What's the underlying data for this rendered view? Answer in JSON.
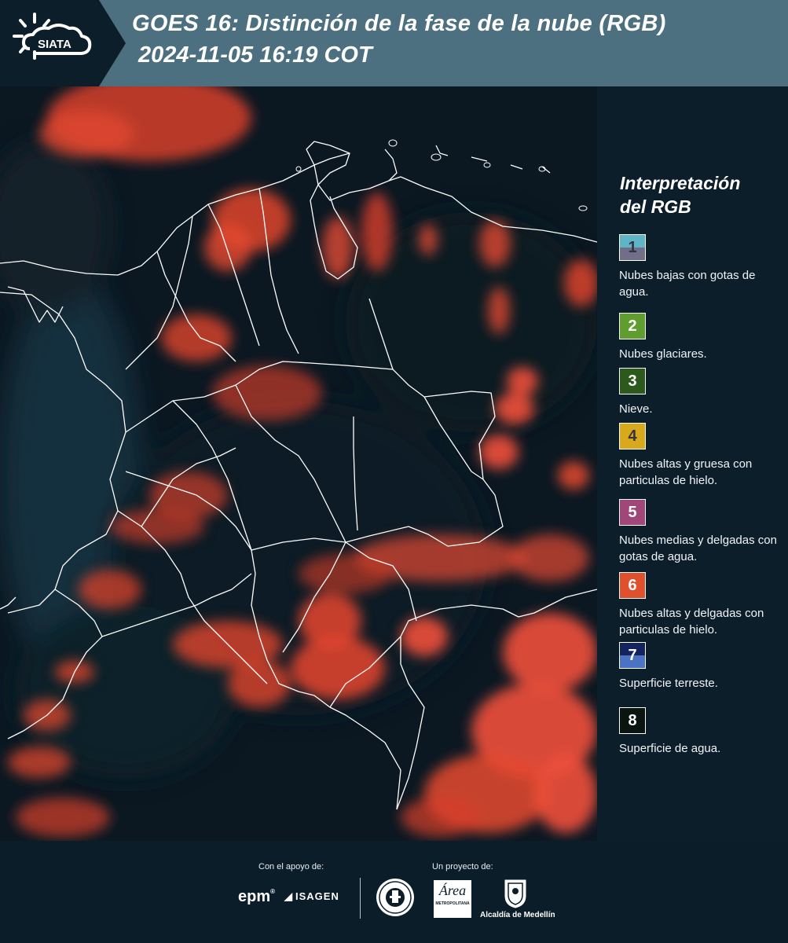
{
  "header": {
    "logo_text": "SIATA",
    "title_line1": "GOES 16: Distinción de la fase de la nube (RGB)",
    "title_line2": "2024-11-05 16:19 COT"
  },
  "legend": {
    "title_line1": "Interpretación",
    "title_line2": "del RGB",
    "items": [
      {
        "number": "1",
        "label": "Nubes bajas con gotas de agua.",
        "color_top": "#5fb4c6",
        "color_bottom": "#6f6f8a"
      },
      {
        "number": "2",
        "label": "Nubes glaciares.",
        "color_top": "#5f9e2e",
        "color_bottom": "#5f9e2e"
      },
      {
        "number": "3",
        "label": "Nieve.",
        "color_top": "#2c5a1c",
        "color_bottom": "#2c5a1c"
      },
      {
        "number": "4",
        "label": "Nubes altas y gruesa con particulas de hielo.",
        "color_top": "#d9a81b",
        "color_bottom": "#d9a81b"
      },
      {
        "number": "5",
        "label": "Nubes medias y delgadas con gotas de agua.",
        "color_top": "#a14678",
        "color_bottom": "#a14678"
      },
      {
        "number": "6",
        "label": "Nubes altas y delgadas con particulas de hielo.",
        "color_top": "#e0502c",
        "color_bottom": "#e0502c"
      },
      {
        "number": "7",
        "label": "Superficie terreste.",
        "color_top": "#13235e",
        "color_bottom": "#4a73c4"
      },
      {
        "number": "8",
        "label": "Superficie de agua.",
        "color_top": "#0a1410",
        "color_bottom": "#0a1410"
      }
    ]
  },
  "footer": {
    "support_label": "Con el apoyo de:",
    "project_label": "Un proyecto de:",
    "epm_text": "epm",
    "isagen_text": "ISAGEN",
    "area_text": "Área",
    "area_sub": "METROPOLITANA",
    "alcaldia_text": "Alcaldía de Medellín"
  },
  "colors": {
    "header_bg": "#4c7080",
    "panel_bg": "#0d1e2b",
    "cloud_red": "#e8432a"
  }
}
